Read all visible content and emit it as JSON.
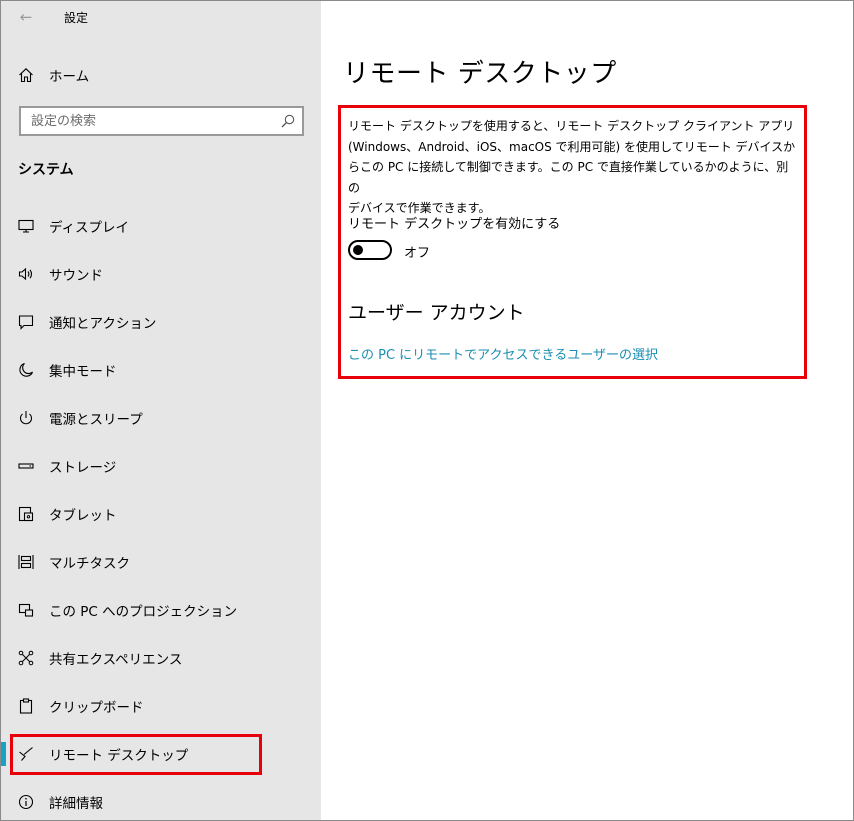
{
  "window": {
    "title": "設定",
    "back_icon": "←"
  },
  "sidebar": {
    "home_label": "ホーム",
    "search_placeholder": "設定の検索",
    "section_title": "システム",
    "items": [
      {
        "label": "ディスプレイ",
        "icon": "display-icon"
      },
      {
        "label": "サウンド",
        "icon": "speaker-icon"
      },
      {
        "label": "通知とアクション",
        "icon": "notification-icon"
      },
      {
        "label": "集中モード",
        "icon": "moon-icon"
      },
      {
        "label": "電源とスリープ",
        "icon": "power-icon"
      },
      {
        "label": "ストレージ",
        "icon": "storage-icon"
      },
      {
        "label": "タブレット",
        "icon": "tablet-icon"
      },
      {
        "label": "マルチタスク",
        "icon": "multitask-icon"
      },
      {
        "label": "この PC へのプロジェクション",
        "icon": "projection-icon"
      },
      {
        "label": "共有エクスペリエンス",
        "icon": "share-icon"
      },
      {
        "label": "クリップボード",
        "icon": "clipboard-icon"
      },
      {
        "label": "リモート デスクトップ",
        "icon": "remote-desktop-icon",
        "selected": true
      },
      {
        "label": "詳細情報",
        "icon": "info-icon"
      }
    ]
  },
  "main": {
    "title": "リモート デスクトップ",
    "description_line1": "リモート デスクトップを使用すると、リモート デスクトップ クライアント アプリ",
    "description_line2": "(Windows、Android、iOS、macOS で利用可能) を使用してリモート デバイスか",
    "description_line3": "らこの PC に接続して制御できます。この PC で直接作業しているかのように、別の",
    "description_line4": "デバイスで作業できます。",
    "toggle_label": "リモート デスクトップを有効にする",
    "toggle_state": "オフ",
    "toggle_on": false,
    "user_accounts_heading": "ユーザー アカウント",
    "user_accounts_link": "この PC にリモートでアクセスできるユーザーの選択"
  },
  "colors": {
    "accent": "#1aa2c4",
    "link": "#1a8eb4",
    "highlight": "#e8000b",
    "sidebar_bg": "#e6e6e6"
  }
}
